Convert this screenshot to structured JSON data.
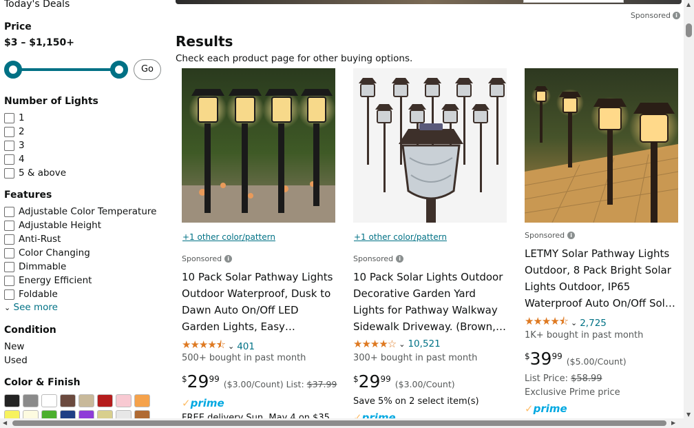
{
  "sidebar": {
    "deals": "Today's Deals",
    "price": {
      "title": "Price",
      "range": "$3 – $1,150+",
      "go": "Go"
    },
    "lights": {
      "title": "Number of Lights",
      "options": [
        "1",
        "2",
        "3",
        "4",
        "5 & above"
      ]
    },
    "features": {
      "title": "Features",
      "options": [
        "Adjustable Color Temperature",
        "Adjustable Height",
        "Anti-Rust",
        "Color Changing",
        "Dimmable",
        "Energy Efficient",
        "Foldable"
      ],
      "see_more": "See more"
    },
    "condition": {
      "title": "Condition",
      "options": [
        "New",
        "Used"
      ]
    },
    "color": {
      "title": "Color & Finish",
      "swatches": [
        "#232323",
        "#8a8a8a",
        "#ffffff",
        "#6b4a3e",
        "#c8b99a",
        "#b51d1d",
        "#f8c9d2",
        "#f5a24b",
        "#f7f25d",
        "#fdfbe0",
        "#4caf2d",
        "#1f3f85",
        "#8e3cd8",
        "#d8cf8d",
        "#e7e7e7",
        "#b06a33"
      ]
    }
  },
  "main": {
    "sponsored": "Sponsored",
    "results_title": "Results",
    "results_sub": "Check each product page for other buying options."
  },
  "products": [
    {
      "link": "+1 other color/pattern",
      "sponsored": "Sponsored",
      "title": "10 Pack Solar Pathway Lights Outdoor Waterproof, Dusk to Dawn Auto On/Off LED Garden Lights, Easy…",
      "stars": "★★★★⯪",
      "reviews": "401",
      "bought": "500+ bought in past month",
      "price_dollars": "29",
      "price_cents": "99",
      "unit": "($3.00/Count)",
      "list_label": "List:",
      "list_price": "$37.99",
      "prime": "prime",
      "delivery": "FREE delivery Sun, May 4 on $35"
    },
    {
      "link": "+1 other color/pattern",
      "sponsored": "Sponsored",
      "title": "10 Pack Solar Lights Outdoor Decorative Garden Yard Lights for Pathway Walkway Sidewalk Driveway. (Brown,…",
      "stars": "★★★★☆",
      "reviews": "10,521",
      "bought": "300+ bought in past month",
      "price_dollars": "29",
      "price_cents": "99",
      "unit": "($3.00/Count)",
      "save": "Save 5% on 2 select item(s)",
      "prime": "prime"
    },
    {
      "sponsored": "Sponsored",
      "title": "LETMY Solar Pathway Lights Outdoor, 8 Pack Bright Solar Lights Outdoor, IP65 Waterproof Auto On/Off Sol…",
      "stars": "★★★★⯪",
      "reviews": "2,725",
      "bought": "1K+ bought in past month",
      "price_dollars": "39",
      "price_cents": "99",
      "unit": "($5.00/Count)",
      "list_label": "List Price:",
      "list_price": "$58.99",
      "exclusive": "Exclusive Prime price",
      "prime": "prime"
    }
  ]
}
